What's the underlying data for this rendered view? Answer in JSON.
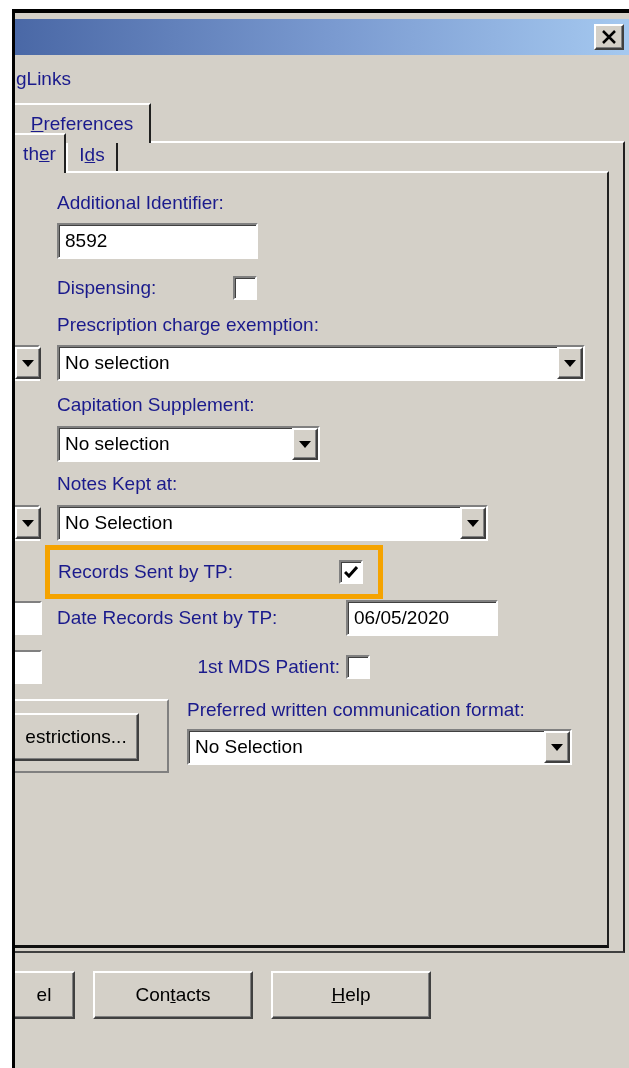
{
  "header_text": "gLinks",
  "tabs_row1": [
    {
      "label": [
        {
          "text": "P",
          "underline": true
        },
        {
          "text": "references",
          "underline": false
        }
      ],
      "selected": true
    }
  ],
  "tabs_row2": [
    {
      "label": [
        {
          "text": "th",
          "underline": false
        },
        {
          "text": "e",
          "underline": true
        },
        {
          "text": "r",
          "underline": false
        }
      ],
      "selected": true
    },
    {
      "label": [
        {
          "text": "I",
          "underline": false
        },
        {
          "text": "d",
          "underline": true
        },
        {
          "text": "s",
          "underline": false
        }
      ],
      "selected": false
    }
  ],
  "form": {
    "additional_identifier": {
      "label": "Additional Identifier:",
      "value": "8592"
    },
    "dispensing": {
      "label": "Dispensing:",
      "checked": false
    },
    "prescription_charge_exemption": {
      "label": "Prescription charge exemption:",
      "value": "No selection"
    },
    "capitation_supplement": {
      "label": "Capitation Supplement:",
      "value": "No selection"
    },
    "notes_kept_at": {
      "label": "Notes Kept at:",
      "value": "No Selection"
    },
    "records_sent_by_tp": {
      "label": "Records Sent by TP:",
      "checked": true,
      "highlighted": true
    },
    "date_records_sent_by_tp": {
      "label": "Date Records Sent by TP:",
      "value": "06/05/2020"
    },
    "first_mds_patient": {
      "label": "1st MDS Patient:",
      "checked": false
    },
    "restrictions_button": "estrictions...",
    "preferred_written_communication_format": {
      "label": "Preferred written communication format:",
      "value": "No Selection"
    }
  },
  "buttons": [
    {
      "label": [
        {
          "text": "el",
          "underline": false
        }
      ]
    },
    {
      "label": [
        {
          "text": "Con",
          "underline": false
        },
        {
          "text": "t",
          "underline": true
        },
        {
          "text": "acts",
          "underline": false
        }
      ]
    },
    {
      "label": [
        {
          "text": "H",
          "underline": true
        },
        {
          "text": "elp",
          "underline": false
        }
      ]
    }
  ]
}
